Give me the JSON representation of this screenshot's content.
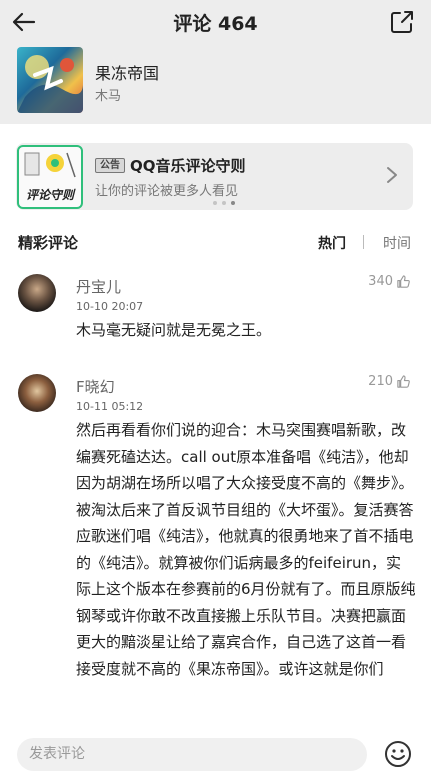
{
  "header": {
    "title": "评论 464"
  },
  "song": {
    "name": "果冻帝国",
    "artist": "木马"
  },
  "notice": {
    "tag": "公告",
    "title": "QQ音乐评论守则",
    "subtitle": "让你的评论被更多人看见",
    "image_text": "评论守则"
  },
  "section": {
    "title": "精彩评论",
    "sort_hot": "热门",
    "sort_time": "时间"
  },
  "comments": [
    {
      "user": "丹宝儿",
      "time": "10-10 20:07",
      "likes": "340",
      "text": "木马毫无疑问就是无冕之王。"
    },
    {
      "user": "F晓幻",
      "time": "10-11 05:12",
      "likes": "210",
      "text": "然后再看看你们说的迎合：木马突围赛唱新歌，改编赛死磕达达。call out原本准备唱《纯洁》，他却因为胡湖在场所以唱了大众接受度不高的《舞步》。被淘汰后来了首反讽节目组的《大坏蛋》。复活赛答应歌迷们唱《纯洁》，他就真的很勇地来了首不插电的《纯洁》。就算被你们诟病最多的feifeirun，实际上这个版本在参赛前的6月份就有了。而且原版纯钢琴或许你敢不改直接搬上乐队节目。决赛把赢面更大的黯淡星让给了嘉宾合作，自己选了这首一看接受度就不高的《果冻帝国》。或许这就是你们"
    }
  ],
  "bottom": {
    "input_placeholder": "发表评论"
  },
  "colors": {
    "header_bg": "#ededed",
    "accent_green": "#2fbf7b"
  }
}
